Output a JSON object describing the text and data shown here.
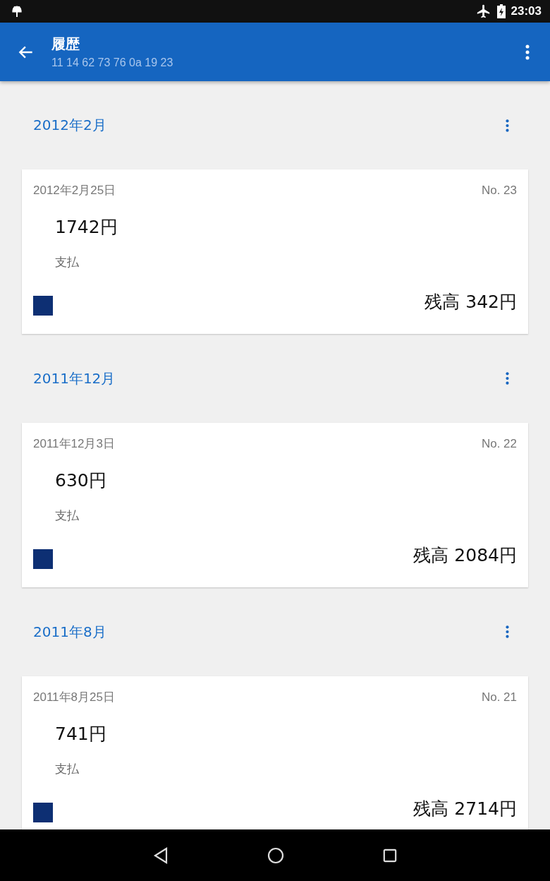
{
  "status_bar": {
    "time": "23:03"
  },
  "app_bar": {
    "title": "履歴",
    "subtitle": "11 14 62 73 76 0a 19 23"
  },
  "sections": [
    {
      "month": "2012年2月",
      "entry": {
        "date": "2012年2月25日",
        "number": "No. 23",
        "amount": "1742円",
        "type": "支払",
        "balance": "残高 342円"
      }
    },
    {
      "month": "2011年12月",
      "entry": {
        "date": "2011年12月3日",
        "number": "No. 22",
        "amount": "630円",
        "type": "支払",
        "balance": "残高 2084円"
      }
    },
    {
      "month": "2011年8月",
      "entry": {
        "date": "2011年8月25日",
        "number": "No. 21",
        "amount": "741円",
        "type": "支払",
        "balance": "残高 2714円"
      }
    }
  ]
}
